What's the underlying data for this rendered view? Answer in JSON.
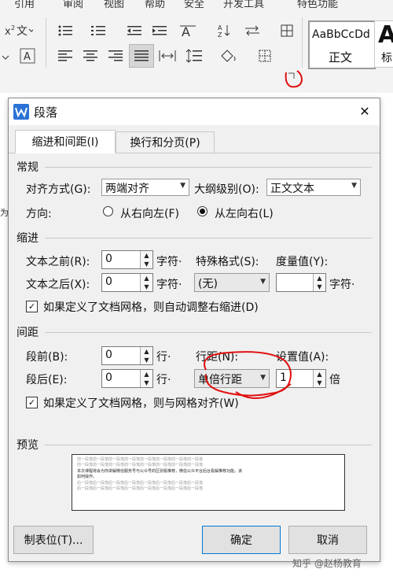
{
  "ribbon": {
    "tabs": [
      "引用",
      "审阅",
      "视图",
      "帮助",
      "安全",
      "开发工具",
      "特色功能"
    ],
    "style_preview_text": "AaBbCcDd",
    "style_name": "正文",
    "style_preview_big": "A",
    "style_name_partial": "标"
  },
  "dialog": {
    "title": "段落",
    "close_glyph": "✕",
    "tabs": {
      "indent_spacing": "缩进和间距(I)",
      "line_page": "换行和分页(P)"
    },
    "general": {
      "section": "常规",
      "alignment_label": "对齐方式(G):",
      "alignment_value": "两端对齐",
      "outline_label": "大纲级别(O):",
      "outline_value": "正文文本",
      "direction_label": "方向:",
      "rtl_label": "从右向左(F)",
      "ltr_label": "从左向右(L)"
    },
    "indent": {
      "section": "缩进",
      "before_label": "文本之前(R):",
      "before_value": "0",
      "before_unit": "字符·",
      "after_label": "文本之后(X):",
      "after_value": "0",
      "after_unit": "字符·",
      "special_label": "特殊格式(S):",
      "special_value": "(无)",
      "measure_label": "度量值(Y):",
      "measure_value": "",
      "measure_unit": "字符·",
      "auto_adjust_label": "如果定义了文档网格，则自动调整右缩进(D)"
    },
    "spacing": {
      "section": "间距",
      "before_label": "段前(B):",
      "before_value": "0",
      "before_unit": "行·",
      "after_label": "段后(E):",
      "after_value": "0",
      "after_unit": "行·",
      "line_label": "行距(N):",
      "line_value": "单倍行距",
      "setting_label": "设置值(A):",
      "setting_value": "1",
      "setting_unit": "倍",
      "grid_align_label": "如果定义了文档网格，则与网格对齐(W)"
    },
    "preview": {
      "section": "预览",
      "filler_line": "前一段落前一段落前一段落前一段落前一段落前一段落前一段落前一段落",
      "sample_text_1": "本次课程将会为你讲解微信服务号与公众号的区别看推荐，微信公众平台后台看解推荐功能。该",
      "sample_text_2": "如何操作。",
      "after_line": "后一段落后一段落后一段落后一段落后一段落后一段落后一段落后一段落"
    },
    "buttons": {
      "tabs": "制表位(T)...",
      "ok": "确定",
      "cancel": "取消"
    }
  },
  "watermark": "知乎 @赵杨教育",
  "annotation_color": "#e01010",
  "accent_color": "#2b73d6"
}
